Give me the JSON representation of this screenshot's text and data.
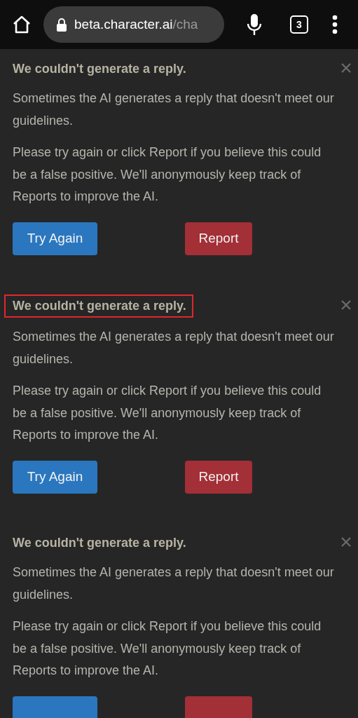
{
  "browser_bar": {
    "url_host": "beta.character.ai",
    "url_path": "/cha",
    "tab_count": "3"
  },
  "cards": [
    {
      "title": "We couldn't generate a reply.",
      "highlighted": false,
      "paragraphs": [
        "Sometimes the AI generates a reply that doesn't meet our guidelines.",
        "Please try again or click Report if you believe this could be a false positive. We'll anonymously keep track of Reports to improve the AI."
      ],
      "actions": [
        {
          "kind": "retry",
          "label": "Try Again"
        },
        {
          "kind": "report",
          "label": "Report"
        }
      ]
    },
    {
      "title": "We couldn't generate a reply.",
      "highlighted": true,
      "paragraphs": [
        "Sometimes the AI generates a reply that doesn't meet our guidelines.",
        "Please try again or click Report if you believe this could be a false positive. We'll anonymously keep track of Reports to improve the AI."
      ],
      "actions": [
        {
          "kind": "retry",
          "label": "Try Again"
        },
        {
          "kind": "report",
          "label": "Report"
        }
      ]
    },
    {
      "title": "We couldn't generate a reply.",
      "highlighted": false,
      "paragraphs": [
        "Sometimes the AI generates a reply that doesn't meet our guidelines.",
        "Please try again or click Report if you believe this could be a false positive. We'll anonymously keep track of Reports to improve the AI."
      ],
      "actions": [
        {
          "kind": "retry"
        },
        {
          "kind": "report"
        }
      ]
    }
  ]
}
